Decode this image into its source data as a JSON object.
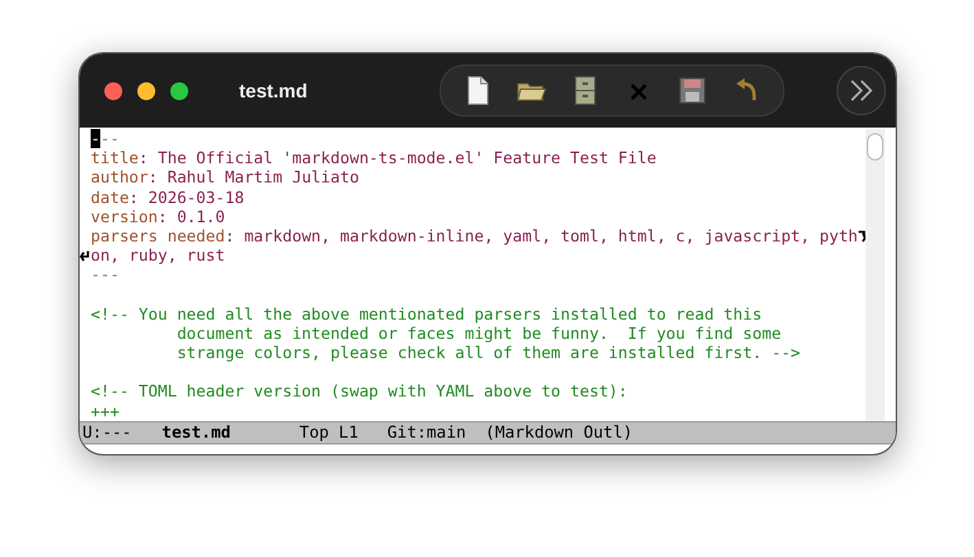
{
  "window": {
    "title": "test.md"
  },
  "toolbar": [
    {
      "kind": "new-file"
    },
    {
      "kind": "open-folder"
    },
    {
      "kind": "cabinet"
    },
    {
      "kind": "close"
    },
    {
      "kind": "save"
    },
    {
      "kind": "undo"
    }
  ],
  "lines": [
    {
      "segments": [
        {
          "kind": "delim",
          "text": "---"
        }
      ],
      "cursor": true
    },
    {
      "segments": [
        {
          "kind": "key",
          "text": "title"
        },
        {
          "kind": "value",
          "text": ": The Official 'markdown-ts-mode.el' Feature Test File"
        }
      ]
    },
    {
      "segments": [
        {
          "kind": "key",
          "text": "author"
        },
        {
          "kind": "value",
          "text": ": Rahul Martim Juliato"
        }
      ]
    },
    {
      "segments": [
        {
          "kind": "key",
          "text": "date"
        },
        {
          "kind": "value",
          "text": ": 2026-03-18"
        }
      ]
    },
    {
      "segments": [
        {
          "kind": "key",
          "text": "version"
        },
        {
          "kind": "value",
          "text": ": 0.1.0"
        }
      ]
    },
    {
      "segments": [
        {
          "kind": "key",
          "text": "parsers needed"
        },
        {
          "kind": "value",
          "text": ": markdown, markdown-inline, yaml, toml, html, c, javascript, pyth"
        }
      ],
      "wraps": true
    },
    {
      "segments": [
        {
          "kind": "value",
          "text": "on, ruby, rust"
        }
      ],
      "continued": true
    },
    {
      "segments": [
        {
          "kind": "delim",
          "text": "---"
        }
      ]
    },
    {
      "gap_before": true,
      "segments": [
        {
          "kind": "comment",
          "text": "<!-- You need all the above mentionated parsers installed to read this"
        }
      ]
    },
    {
      "segments": [
        {
          "kind": "comment",
          "text": "         document as intended or faces might be funny.  If you find some"
        }
      ]
    },
    {
      "segments": [
        {
          "kind": "comment",
          "text": "         strange colors, please check all of them are installed first. -->"
        }
      ]
    },
    {
      "gap_before": true,
      "segments": [
        {
          "kind": "comment",
          "text": "<!-- TOML header version (swap with YAML above to test):"
        }
      ]
    },
    {
      "segments": [
        {
          "kind": "comment",
          "text": "+++"
        }
      ]
    }
  ],
  "mode_line": {
    "status": "U:---",
    "buffer": "test.md",
    "position": "Top L1",
    "vc": "Git:main",
    "mode": "(Markdown Outl)"
  }
}
